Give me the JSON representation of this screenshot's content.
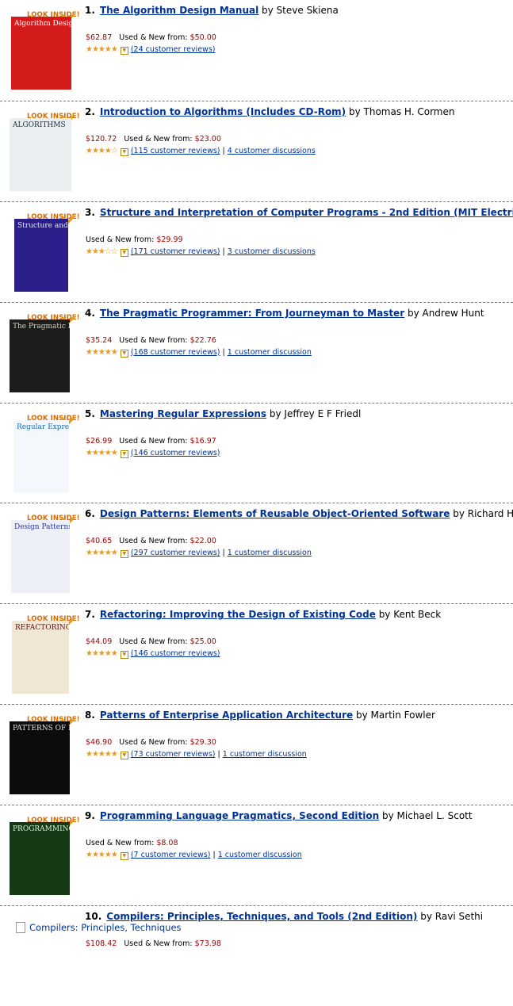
{
  "look_inside_label": "LOOK INSIDE!",
  "review_sep": "|",
  "colors": {
    "link": "#003399",
    "price": "#990000",
    "star": "#e69a1f",
    "badge": "#d86a00"
  },
  "items": [
    {
      "num": "1.",
      "title": "The Algorithm Design Manual",
      "by": "by Steve Skiena",
      "price": "$62.87",
      "used_label": "Used & New from:",
      "used_price": "$50.00",
      "stars": "★★★★★",
      "reviews": "(24 customer reviews)",
      "discussions": "",
      "cover_text": "Algorithm Design MANUAL"
    },
    {
      "num": "2.",
      "title": "Introduction to Algorithms (Includes CD-Rom)",
      "by": "by Thomas H. Cormen",
      "price": "$120.72",
      "used_label": "Used & New from:",
      "used_price": "$23.00",
      "stars": "★★★★☆",
      "reviews": "(115 customer reviews)",
      "discussions": "4 customer discussions",
      "cover_text": "ALGORITHMS"
    },
    {
      "num": "3.",
      "title": "Structure and Interpretation of Computer Programs - 2nd Edition (MIT Electrica",
      "by": "",
      "price": "",
      "used_label": "Used & New from:",
      "used_price": "$29.99",
      "stars": "★★★☆☆",
      "reviews": "(171 customer reviews)",
      "discussions": "3 customer discussions",
      "cover_text": "Structure and Interpretation of Computer Programs"
    },
    {
      "num": "4.",
      "title": "The Pragmatic Programmer: From Journeyman to Master",
      "by": "by Andrew Hunt",
      "price": "$35.24",
      "used_label": "Used & New from:",
      "used_price": "$22.76",
      "stars": "★★★★★",
      "reviews": "(168 customer reviews)",
      "discussions": "1 customer discussion",
      "cover_text": "The Pragmatic Programmer"
    },
    {
      "num": "5.",
      "title": "Mastering Regular Expressions",
      "by": "by Jeffrey E F Friedl",
      "price": "$26.99",
      "used_label": "Used & New from:",
      "used_price": "$16.97",
      "stars": "★★★★★",
      "reviews": "(146 customer reviews)",
      "discussions": "",
      "cover_text": "Regular Expressions"
    },
    {
      "num": "6.",
      "title": "Design Patterns: Elements of Reusable Object-Oriented Software",
      "by": "by Richard Helm",
      "price": "$40.65",
      "used_label": "Used & New from:",
      "used_price": "$22.00",
      "stars": "★★★★★",
      "reviews": "(297 customer reviews)",
      "discussions": "1 customer discussion",
      "cover_text": "Design Patterns"
    },
    {
      "num": "7.",
      "title": "Refactoring: Improving the Design of Existing Code",
      "by": "by Kent Beck",
      "price": "$44.09",
      "used_label": "Used & New from:",
      "used_price": "$25.00",
      "stars": "★★★★★",
      "reviews": "(146 customer reviews)",
      "discussions": "",
      "cover_text": "REFACTORING"
    },
    {
      "num": "8.",
      "title": "Patterns of Enterprise Application Architecture",
      "by": "by Martin Fowler",
      "price": "$46.90",
      "used_label": "Used & New from:",
      "used_price": "$29.30",
      "stars": "★★★★★",
      "reviews": "(73 customer reviews)",
      "discussions": "1 customer discussion",
      "cover_text": "PATTERNS OF ENTERPRISE APPLICATION ARCHITECTURE"
    },
    {
      "num": "9.",
      "title": "Programming Language Pragmatics, Second Edition",
      "by": "by Michael L. Scott",
      "price": "",
      "used_label": "Used & New from:",
      "used_price": "$8.08",
      "stars": "★★★★★",
      "reviews": "(7 customer reviews)",
      "discussions": "1 customer discussion",
      "cover_text": "PROGRAMMING LANGUAGE PRAGMATICS"
    },
    {
      "num": "10.",
      "title": "Compilers: Principles, Techniques, and Tools (2nd Edition)",
      "by": "by Ravi Sethi",
      "price": "$108.42",
      "used_label": "Used & New from:",
      "used_price": "$73.98",
      "stars": "",
      "reviews": "",
      "discussions": "",
      "broken_alt": "Compilers: Principles, Techniques"
    }
  ]
}
